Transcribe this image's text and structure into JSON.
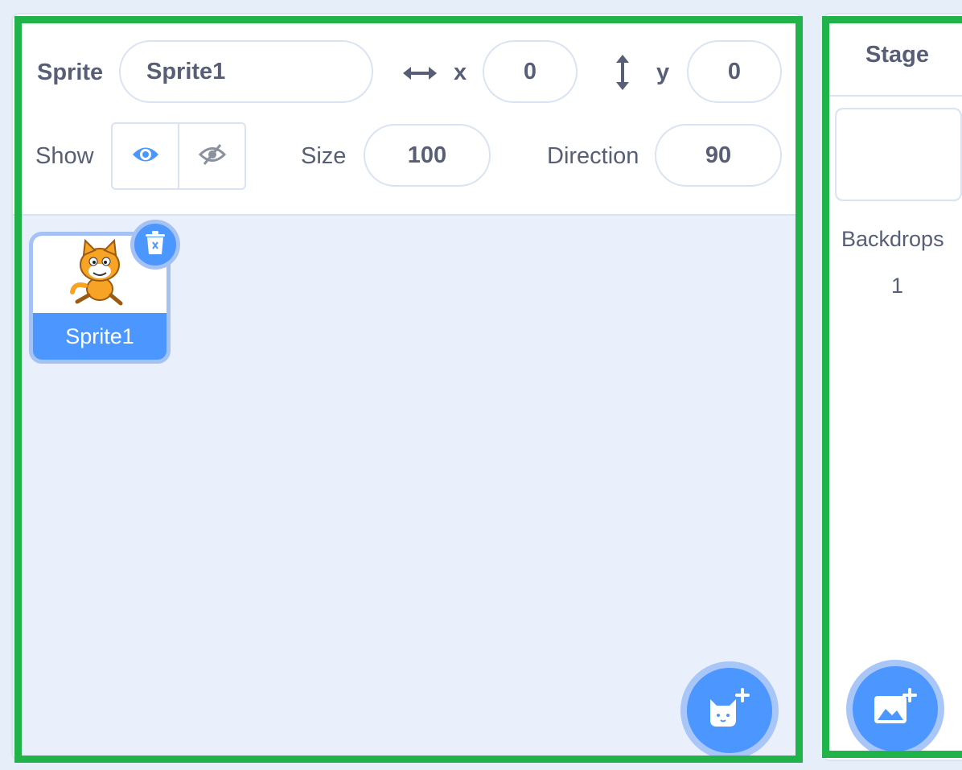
{
  "sprite_info": {
    "sprite_label": "Sprite",
    "sprite_name": "Sprite1",
    "x_label": "x",
    "x_value": "0",
    "y_label": "y",
    "y_value": "0",
    "show_label": "Show",
    "size_label": "Size",
    "size_value": "100",
    "direction_label": "Direction",
    "direction_value": "90"
  },
  "sprite_list": {
    "sprites": [
      {
        "name": "Sprite1",
        "selected": true
      }
    ]
  },
  "stage_panel": {
    "title": "Stage",
    "backdrops_label": "Backdrops",
    "backdrops_count": "1"
  },
  "colors": {
    "accent": "#4c97ff",
    "highlight": "#1fb34a",
    "text": "#575e75"
  },
  "icons": [
    "x-arrows-icon",
    "y-arrows-icon",
    "eye-icon",
    "eye-hidden-icon",
    "trash-icon",
    "cat-sprite-icon",
    "add-sprite-icon",
    "add-backdrop-icon"
  ]
}
